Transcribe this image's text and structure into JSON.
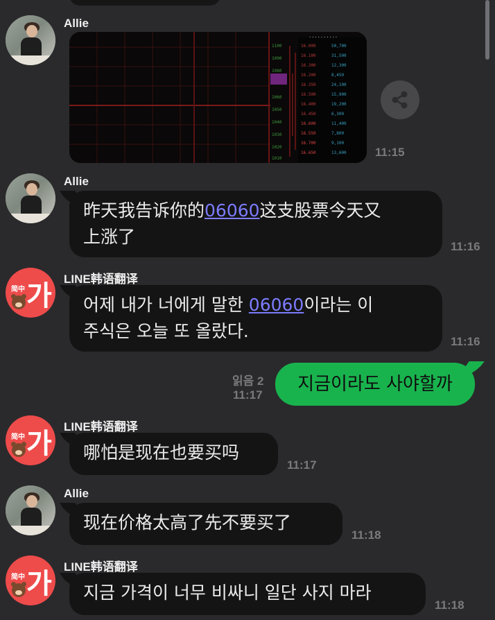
{
  "messages": [
    {
      "sender": "Allie",
      "type": "image",
      "time": "11:15",
      "image_alt": "stock ticker screenshot"
    },
    {
      "sender": "Allie",
      "type": "text",
      "line1_pre": "昨天我告诉你的",
      "link": "06060",
      "line1_post": "这支股票今天又",
      "line2": "上涨了",
      "time": "11:16"
    },
    {
      "sender": "LINE韩语翻译",
      "type": "text",
      "line1_pre": "어제 내가 너에게 말한 ",
      "link": "06060",
      "line1_post": "이라는 이",
      "line2": "주식은 오늘 또 올랐다.",
      "time": "11:16"
    },
    {
      "sender": "me",
      "type": "text",
      "text": "지금이라도 사야할까",
      "read": "읽음 2",
      "time": "11:17"
    },
    {
      "sender": "LINE韩语翻译",
      "type": "text",
      "text": "哪怕是现在也要买吗",
      "time": "11:17"
    },
    {
      "sender": "Allie",
      "type": "text",
      "text": "现在价格太高了先不要买了",
      "time": "11:18"
    },
    {
      "sender": "LINE韩语翻译",
      "type": "text",
      "text": "지금 가격이 너무 비싸니 일단 사지 마라",
      "time": "11:18"
    }
  ],
  "translator_avatar": {
    "glyph": "가",
    "label": "简中"
  },
  "colors": {
    "background": "#2a2a2c",
    "bubble": "#141415",
    "my_bubble": "#19b34e",
    "link": "#7c7cff",
    "translator_avatar": "#ee4b4b"
  }
}
